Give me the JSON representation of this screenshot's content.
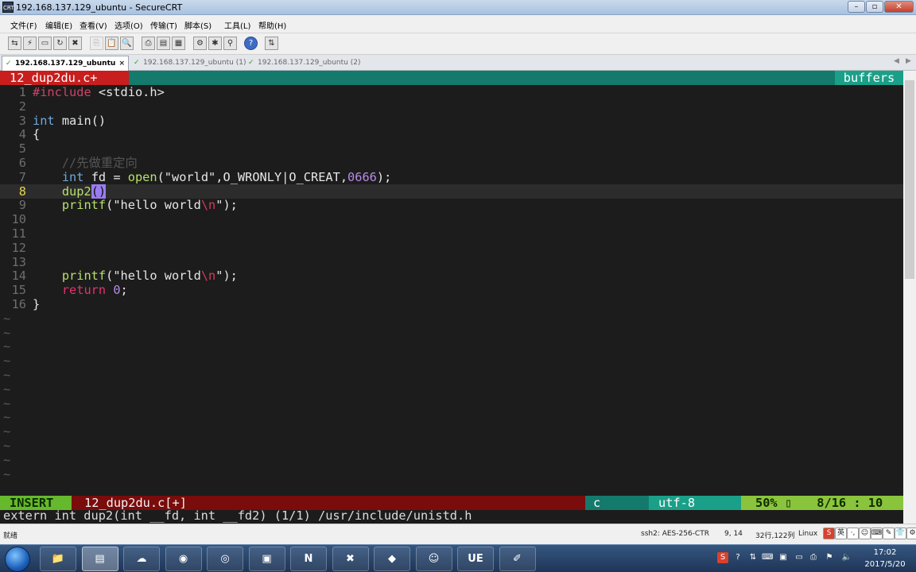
{
  "window": {
    "title": "192.168.137.129_ubuntu - SecureCRT",
    "app_icon_text": "CRT"
  },
  "menu": [
    "文件(F)",
    "编辑(E)",
    "查看(V)",
    "选项(O)",
    "传输(T)",
    "脚本(S)",
    "工具(L)",
    "帮助(H)"
  ],
  "toolbar_icons": [
    "connect-icon",
    "quick-connect-icon",
    "connect-tab-icon",
    "reconnect-icon",
    "disconnect-icon",
    "copy-icon",
    "paste-icon",
    "find-icon",
    "print-icon",
    "print-setup-icon",
    "print-preview-icon",
    "session-options-icon",
    "global-options-icon",
    "keymap-icon",
    "help-icon",
    "sftp-icon"
  ],
  "tabs": [
    {
      "label": "192.168.137.129_ubuntu",
      "active": true,
      "close": "×"
    },
    {
      "label": "192.168.137.129_ubuntu (1)",
      "active": false
    },
    {
      "label": "192.168.137.129_ubuntu (2)",
      "active": false
    }
  ],
  "vim": {
    "tabline_file": "12_dup2du.c+",
    "tabline_buffers": "buffers",
    "lines": [
      {
        "n": "1",
        "segments": [
          [
            "pp",
            "#include"
          ],
          [
            "t",
            " <stdio.h>"
          ]
        ]
      },
      {
        "n": "2",
        "segments": []
      },
      {
        "n": "3",
        "segments": [
          [
            "kw",
            "int"
          ],
          [
            "t",
            " main()"
          ]
        ]
      },
      {
        "n": "4",
        "segments": [
          [
            "t",
            "{"
          ]
        ]
      },
      {
        "n": "5",
        "segments": []
      },
      {
        "n": "6",
        "segments": [
          [
            "t",
            "    "
          ],
          [
            "cm",
            "//先做重定向"
          ]
        ]
      },
      {
        "n": "7",
        "segments": [
          [
            "t",
            "    "
          ],
          [
            "kw",
            "int"
          ],
          [
            "t",
            " fd = "
          ],
          [
            "fn",
            "open"
          ],
          [
            "t",
            "(\"world\",O_WRONLY|O_CREAT,"
          ],
          [
            "num",
            "0666"
          ],
          [
            "t",
            ");"
          ]
        ]
      },
      {
        "n": "8",
        "segments": [
          [
            "t",
            "    "
          ],
          [
            "fn",
            "dup2"
          ],
          [
            "cur",
            "()"
          ]
        ],
        "current": true
      },
      {
        "n": "9",
        "segments": [
          [
            "t",
            "    "
          ],
          [
            "fn",
            "printf"
          ],
          [
            "t",
            "(\"hello world"
          ],
          [
            "esc",
            "\\n"
          ],
          [
            "t",
            "\");"
          ]
        ]
      },
      {
        "n": "10",
        "segments": []
      },
      {
        "n": "11",
        "segments": []
      },
      {
        "n": "12",
        "segments": []
      },
      {
        "n": "13",
        "segments": []
      },
      {
        "n": "14",
        "segments": [
          [
            "t",
            "    "
          ],
          [
            "fn",
            "printf"
          ],
          [
            "t",
            "(\"hello world"
          ],
          [
            "esc",
            "\\n"
          ],
          [
            "t",
            "\");"
          ]
        ]
      },
      {
        "n": "15",
        "segments": [
          [
            "t",
            "    "
          ],
          [
            "ret",
            "return"
          ],
          [
            "t",
            " "
          ],
          [
            "num",
            "0"
          ],
          [
            "t",
            ";"
          ]
        ]
      },
      {
        "n": "16",
        "segments": [
          [
            "t",
            "}"
          ]
        ]
      }
    ],
    "tilde": "~",
    "tilde_count": 12,
    "status": {
      "mode": "INSERT",
      "file": "12_dup2du.c[+]",
      "filetype": "c",
      "encoding": "utf-8",
      "percent": "50%",
      "percent_icon": "▯",
      "position": "8/16  :  10"
    },
    "cmdline": "extern int dup2(int __fd, int __fd2) (1/1) /usr/include/unistd.h"
  },
  "crt_status": {
    "ready": "就绪",
    "cipher": "ssh2: AES-256-CTR",
    "cursor": "9,  14",
    "size": "32行,122列",
    "os": "Linux"
  },
  "ime": [
    "S",
    "英",
    "·,",
    "☺",
    "⌨",
    "✎",
    "👕",
    "⚙"
  ],
  "taskbar": {
    "apps": [
      "explorer-icon",
      "securecrt-icon",
      "network-icon",
      "firefox-icon",
      "chrome-icon",
      "green-app-icon",
      "onenote-icon",
      "xmind-icon",
      "notes-icon",
      "qq-icon",
      "ultraedit-icon",
      "paint-icon"
    ],
    "app_glyphs": [
      "📁",
      "▤",
      "☁",
      "◉",
      "◎",
      "▣",
      "N",
      "✖",
      "◆",
      "☺",
      "UE",
      "✐"
    ],
    "active_index": 1,
    "clock_time": "17:02",
    "clock_date": "2017/5/20"
  }
}
